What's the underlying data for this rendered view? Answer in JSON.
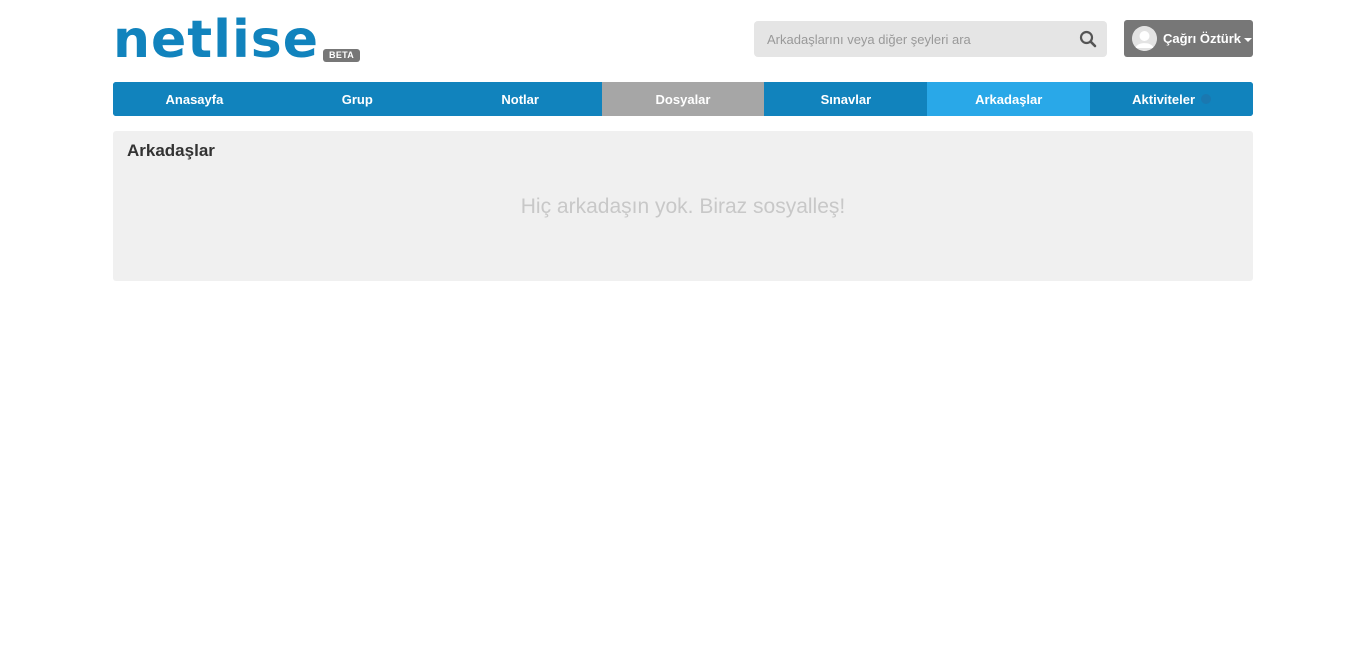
{
  "header": {
    "logo_text": "netlise",
    "beta_label": "BETA",
    "search_placeholder": "Arkadaşlarını veya diğer şeyleri ara",
    "search_icon": "search-icon",
    "user_name": "Çağrı Öztürk",
    "avatar_icon": "user-avatar-icon",
    "caret_icon": "caret-down-icon"
  },
  "nav": {
    "items": [
      {
        "label": "Anasayfa"
      },
      {
        "label": "Grup"
      },
      {
        "label": "Notlar"
      },
      {
        "label": "Dosyalar"
      },
      {
        "label": "Sınavlar"
      },
      {
        "label": "Arkadaşlar"
      },
      {
        "label": "Aktiviteler"
      }
    ],
    "active": "Arkadaşlar"
  },
  "main": {
    "title": "Arkadaşlar",
    "empty_message": "Hiç arkadaşın yok. Biraz sosyalleş!"
  },
  "colors": {
    "brand": "#1183bd",
    "nav_active": "#29a8e8",
    "nav_gray": "#a6a6a6",
    "user_button": "#777777",
    "panel_bg": "#f0f0f0"
  }
}
